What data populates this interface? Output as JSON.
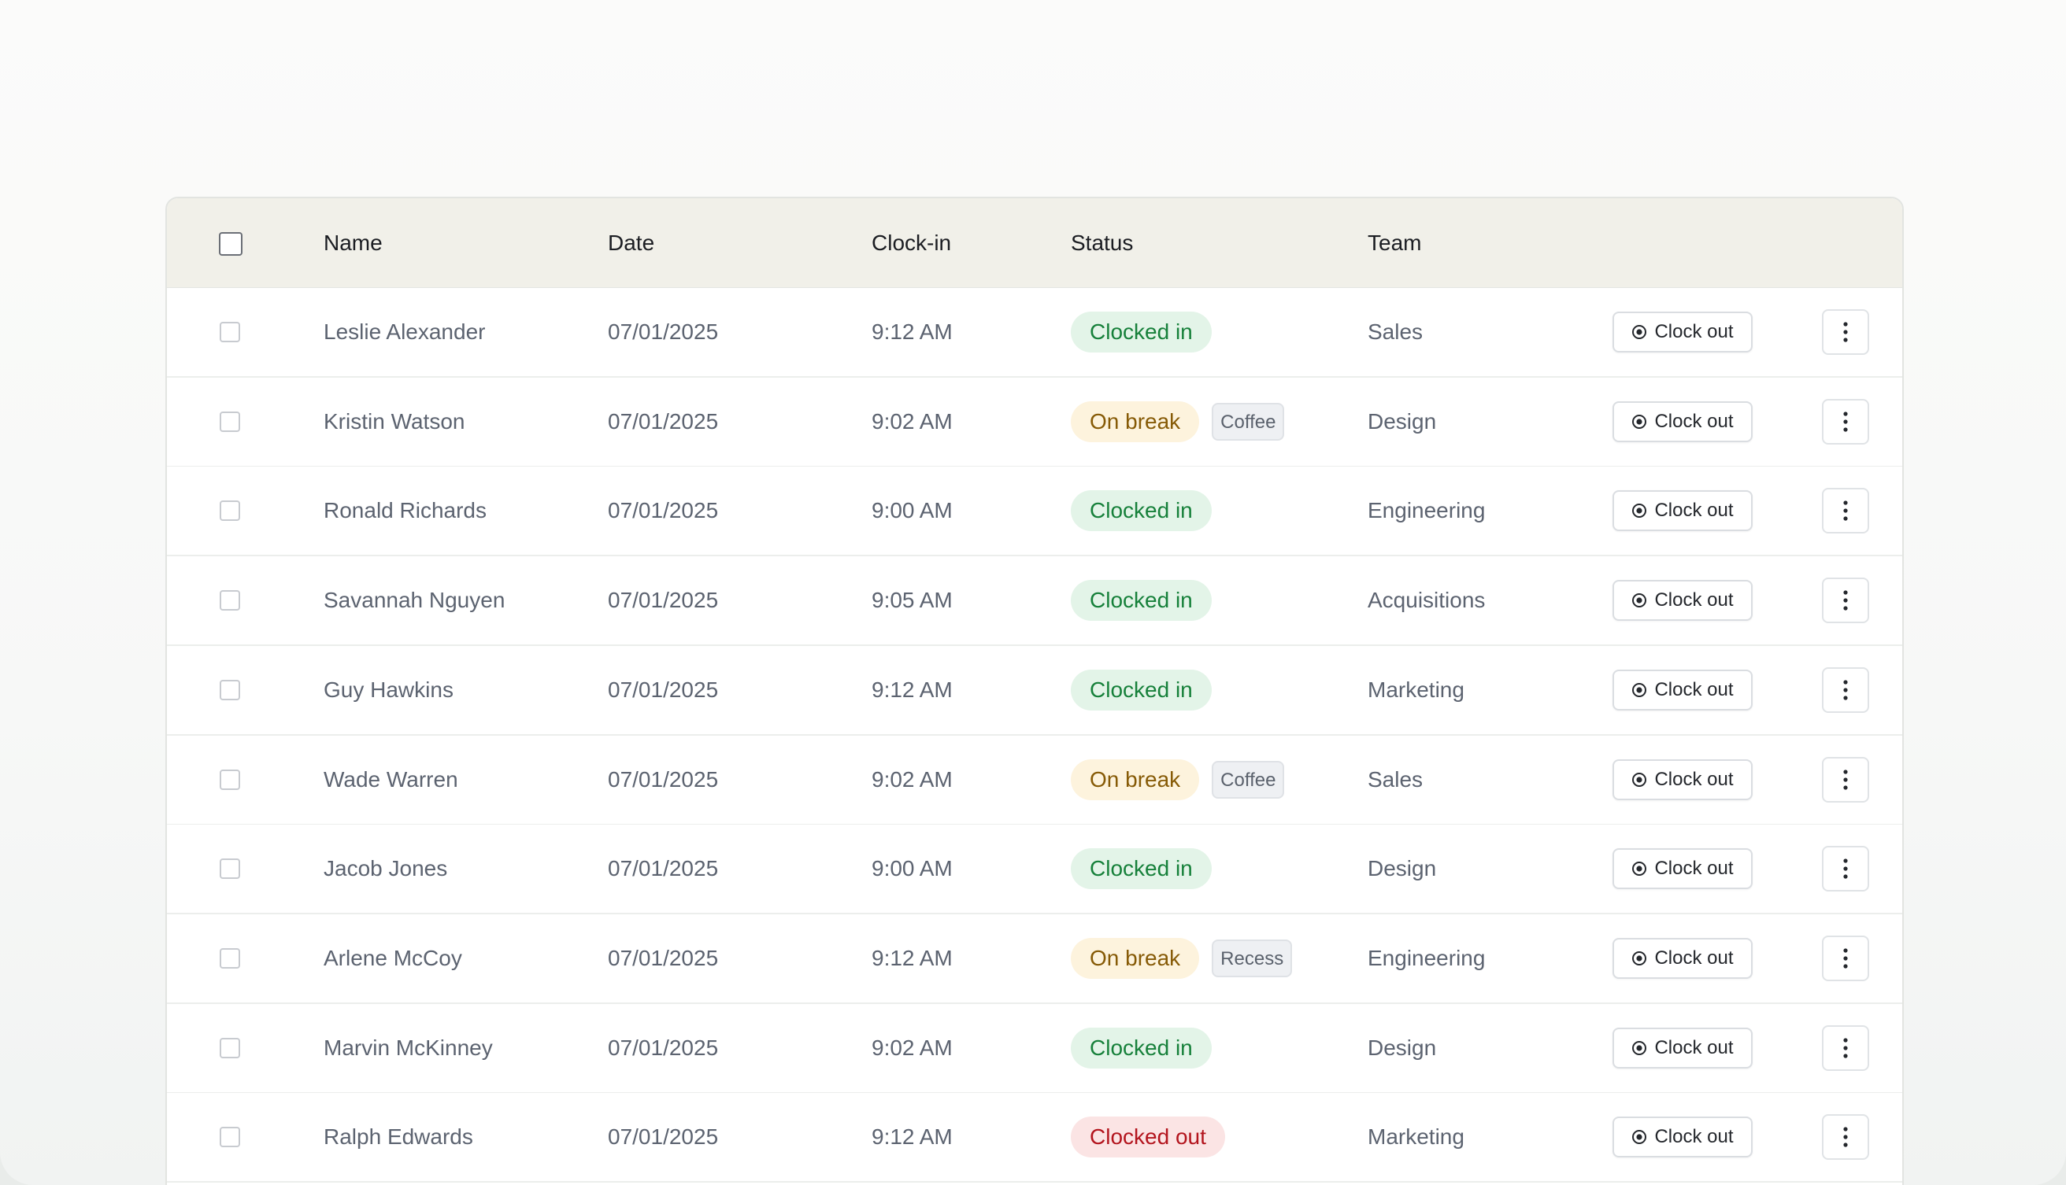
{
  "table": {
    "headers": {
      "name": "Name",
      "date": "Date",
      "clock_in": "Clock-in",
      "status": "Status",
      "team": "Team"
    },
    "action_label": "Clock out",
    "action_icon": "clock-out-icon",
    "more_icon": "more-vertical-icon",
    "status_colors": {
      "clocked_in": "#16803a",
      "on_break": "#865a06",
      "clocked_out": "#b3141d"
    },
    "rows": [
      {
        "name": "Leslie Alexander",
        "date": "07/01/2025",
        "clock_in": "9:12 AM",
        "status": "Clocked in",
        "status_kind": "in",
        "tag": "",
        "team": "Sales"
      },
      {
        "name": "Kristin Watson",
        "date": "07/01/2025",
        "clock_in": "9:02 AM",
        "status": "On break",
        "status_kind": "brk",
        "tag": "Coffee",
        "team": "Design"
      },
      {
        "name": "Ronald Richards",
        "date": "07/01/2025",
        "clock_in": "9:00 AM",
        "status": "Clocked in",
        "status_kind": "in",
        "tag": "",
        "team": "Engineering"
      },
      {
        "name": "Savannah Nguyen",
        "date": "07/01/2025",
        "clock_in": "9:05 AM",
        "status": "Clocked in",
        "status_kind": "in",
        "tag": "",
        "team": "Acquisitions"
      },
      {
        "name": "Guy Hawkins",
        "date": "07/01/2025",
        "clock_in": "9:12 AM",
        "status": "Clocked in",
        "status_kind": "in",
        "tag": "",
        "team": "Marketing"
      },
      {
        "name": "Wade Warren",
        "date": "07/01/2025",
        "clock_in": "9:02 AM",
        "status": "On break",
        "status_kind": "brk",
        "tag": "Coffee",
        "team": "Sales"
      },
      {
        "name": "Jacob Jones",
        "date": "07/01/2025",
        "clock_in": "9:00 AM",
        "status": "Clocked in",
        "status_kind": "in",
        "tag": "",
        "team": "Design"
      },
      {
        "name": "Arlene McCoy",
        "date": "07/01/2025",
        "clock_in": "9:12 AM",
        "status": "On break",
        "status_kind": "brk",
        "tag": "Recess",
        "team": "Engineering"
      },
      {
        "name": "Marvin McKinney",
        "date": "07/01/2025",
        "clock_in": "9:02 AM",
        "status": "Clocked in",
        "status_kind": "in",
        "tag": "",
        "team": "Design"
      },
      {
        "name": "Ralph Edwards",
        "date": "07/01/2025",
        "clock_in": "9:12 AM",
        "status": "Clocked out",
        "status_kind": "out",
        "tag": "",
        "team": "Marketing"
      }
    ]
  }
}
